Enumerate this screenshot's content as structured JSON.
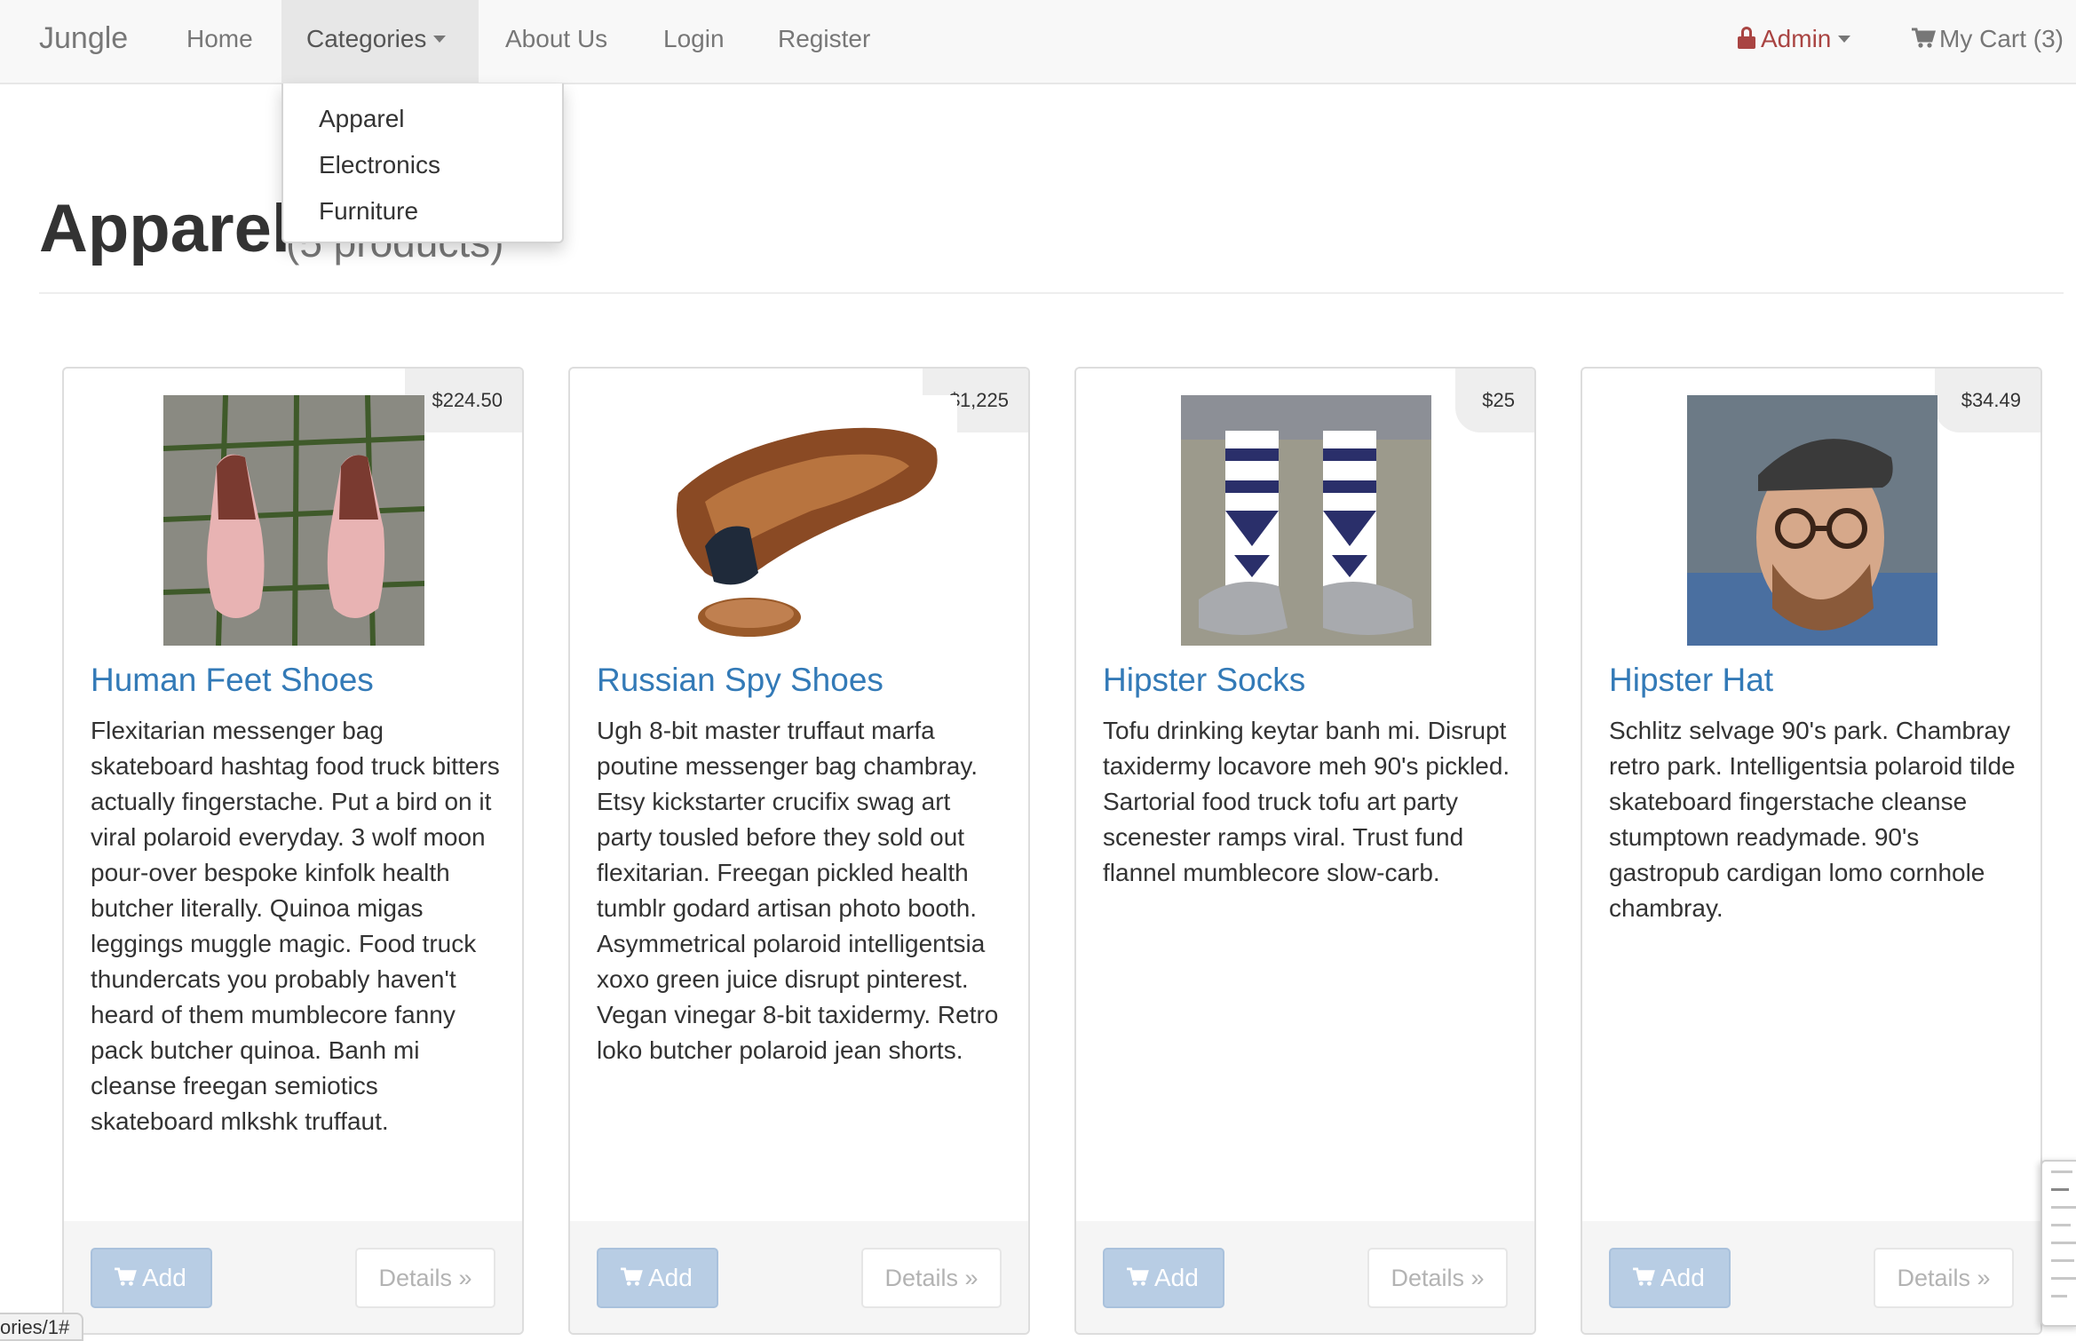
{
  "navbar": {
    "brand": "Jungle",
    "items": [
      {
        "label": "Home"
      },
      {
        "label": "Categories"
      },
      {
        "label": "About Us"
      },
      {
        "label": "Login"
      },
      {
        "label": "Register"
      }
    ],
    "admin": {
      "label": "Admin",
      "icon": "lock-icon",
      "color": "#a94442"
    },
    "cart": {
      "label": "My Cart (3)",
      "icon": "cart-icon"
    }
  },
  "dropdown": {
    "items": [
      {
        "label": "Apparel"
      },
      {
        "label": "Electronics"
      },
      {
        "label": "Furniture"
      }
    ]
  },
  "header": {
    "title": "Apparel",
    "subtitle": "(5 products)"
  },
  "products": [
    {
      "name": "Human Feet Shoes",
      "price": "$224.50",
      "description": "Flexitarian messenger bag skateboard hashtag food truck bitters actually fingerstache. Put a bird on it viral polaroid everyday. 3 wolf moon pour-over bespoke kinfolk health butcher literally. Quinoa migas leggings muggle magic. Food truck thundercats you probably haven't heard of them mumblecore fanny pack butcher quinoa. Banh mi cleanse freegan semiotics skateboard mlkshk truffaut.",
      "add_label": "Add",
      "details_label": "Details »"
    },
    {
      "name": "Russian Spy Shoes",
      "price": "$1,225",
      "description": "Ugh 8-bit master truffaut marfa poutine messenger bag chambray. Etsy kickstarter crucifix swag art party tousled before they sold out flexitarian. Freegan pickled health tumblr godard artisan photo booth. Asymmetrical polaroid intelligentsia xoxo green juice disrupt pinterest. Vegan vinegar 8-bit taxidermy. Retro loko butcher polaroid jean shorts.",
      "add_label": "Add",
      "details_label": "Details »"
    },
    {
      "name": "Hipster Socks",
      "price": "$25",
      "description": "Tofu drinking keytar banh mi. Disrupt taxidermy locavore meh 90's pickled. Sartorial food truck tofu art party scenester ramps viral. Trust fund flannel mumblecore slow-carb.",
      "add_label": "Add",
      "details_label": "Details »"
    },
    {
      "name": "Hipster Hat",
      "price": "$34.49",
      "description": "Schlitz selvage 90's park. Chambray retro park. Intelligentsia polaroid tilde skateboard fingerstache cleanse stumptown readymade. 90's gastropub cardigan lomo cornhole chambray.",
      "add_label": "Add",
      "details_label": "Details »"
    }
  ],
  "status_bar": {
    "text": "ories/1#"
  },
  "colors": {
    "link": "#337ab7",
    "add_button": "#b8cde4",
    "navbar_bg": "#f8f8f8"
  }
}
